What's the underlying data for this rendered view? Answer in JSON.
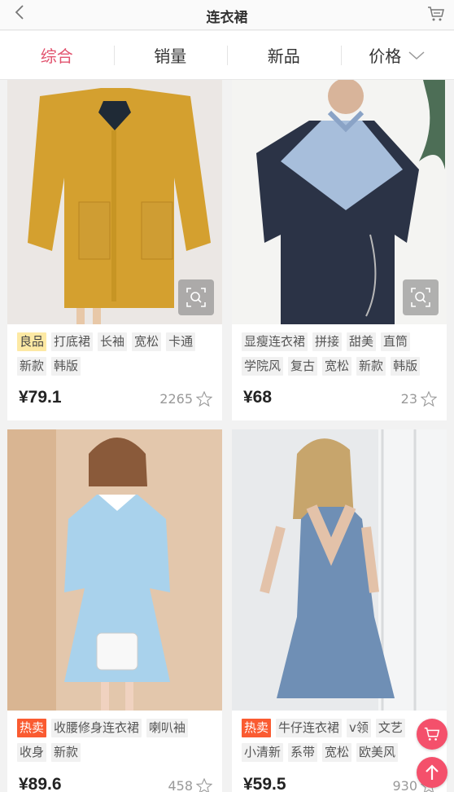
{
  "header": {
    "title": "连衣裙",
    "back_icon": "chevron-left-icon",
    "cart_icon": "cart-icon"
  },
  "tabs": [
    {
      "label": "综合",
      "active": true
    },
    {
      "label": "销量",
      "active": false
    },
    {
      "label": "新品",
      "active": false
    },
    {
      "label": "价格",
      "active": false,
      "icon": "chevron-down-icon"
    }
  ],
  "products": [
    {
      "tags": [
        "良品",
        "打底裙",
        "长袖",
        "宽松",
        "卡通",
        "新款",
        "韩版"
      ],
      "highlight_tag": "良品",
      "price": "¥79.1",
      "sales": "2265"
    },
    {
      "tags": [
        "显瘦连衣裙",
        "拼接",
        "甜美",
        "直筒",
        "学院风",
        "复古",
        "宽松",
        "新款",
        "韩版"
      ],
      "price": "¥68",
      "sales": "23"
    },
    {
      "tags": [
        "热卖",
        "收腰修身连衣裙",
        "喇叭袖",
        "收身",
        "新款"
      ],
      "hot_tag": "热卖",
      "price": "¥89.6",
      "sales": "458"
    },
    {
      "tags": [
        "热卖",
        "牛仔连衣裙",
        "v领",
        "文艺",
        "小清新",
        "系带",
        "宽松",
        "欧美风"
      ],
      "hot_tag": "热卖",
      "price": "¥59.5",
      "sales": "930"
    }
  ],
  "colors": {
    "accent": "#e2546f",
    "hot": "#fa5b31",
    "fab": "#f4506b",
    "highlight": "#fde9a4"
  }
}
